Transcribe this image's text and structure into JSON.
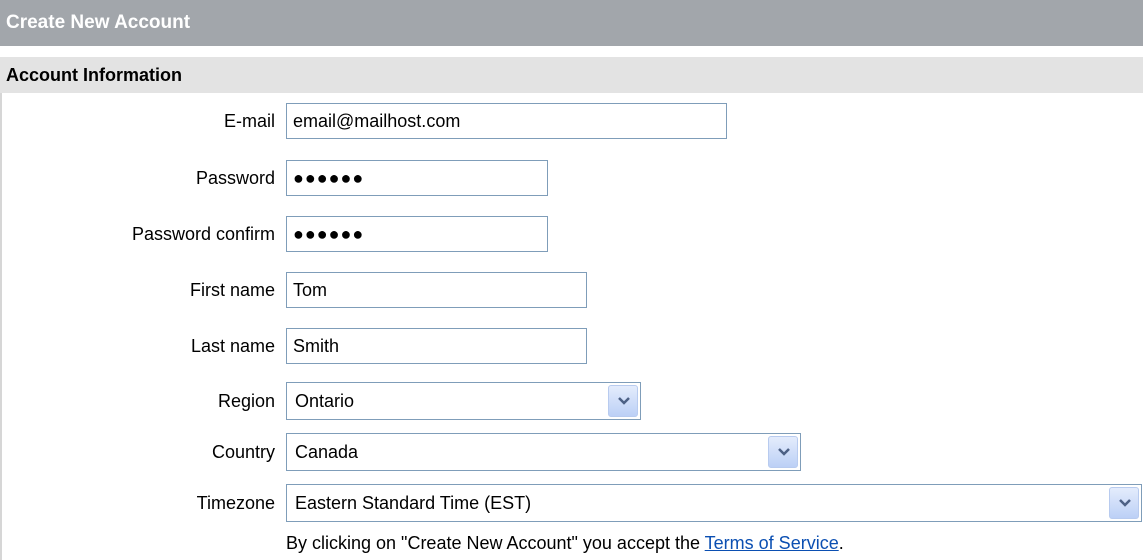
{
  "header": {
    "title": "Create New Account"
  },
  "section": {
    "title": "Account Information"
  },
  "form": {
    "email": {
      "label": "E-mail",
      "value": "email@mailhost.com"
    },
    "password": {
      "label": "Password",
      "value": "●●●●●●"
    },
    "password_confirm": {
      "label": "Password confirm",
      "value": "●●●●●●"
    },
    "first_name": {
      "label": "First name",
      "value": "Tom"
    },
    "last_name": {
      "label": "Last name",
      "value": "Smith"
    },
    "region": {
      "label": "Region",
      "value": "Ontario"
    },
    "country": {
      "label": "Country",
      "value": "Canada"
    },
    "timezone": {
      "label": "Timezone",
      "value": "Eastern Standard Time (EST)"
    }
  },
  "terms": {
    "text_before": "By clicking on \"Create New Account\" you accept the ",
    "link_text": "Terms of Service",
    "text_after": "."
  },
  "icons": {
    "dropdown": "chevron-down-icon"
  },
  "colors": {
    "title_bar": "#a2a6ab",
    "section_bar": "#e3e3e3",
    "field_border": "#7f9db9",
    "link": "#0b4fb2"
  }
}
